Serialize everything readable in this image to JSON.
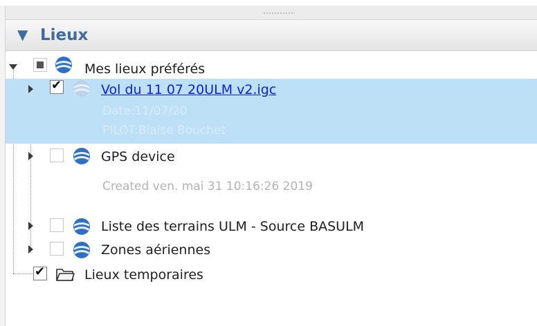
{
  "panel": {
    "title": "Lieux",
    "collapse_glyph": "▼"
  },
  "tree": {
    "root": {
      "label": "Mes lieux préférés",
      "state": "partial",
      "expanded": true,
      "icon": "globe-icon"
    },
    "children": [
      {
        "label": "Vol du 11 07 20ULM v2.igc",
        "checked": true,
        "selected": true,
        "link": true,
        "icon": "globe-icon",
        "description": [
          "Date:11/07/20",
          "PILOT:Blaise Bouchet"
        ]
      },
      {
        "label": "GPS device",
        "checked": false,
        "icon": "globe-icon",
        "description": [
          "Created ven. mai 31 10:16:26 2019"
        ]
      },
      {
        "label": "Liste des terrains ULM - Source BASULM",
        "checked": false,
        "icon": "globe-icon"
      },
      {
        "label": "Zones aériennes",
        "checked": false,
        "icon": "globe-icon"
      }
    ],
    "temporary": {
      "label": "Lieux temporaires",
      "checked": true,
      "icon": "folder-icon"
    }
  },
  "colors": {
    "header_text": "#3e6c9d",
    "selection": "#bee0f7",
    "link": "#0b1fd6",
    "description": "#b3b3b3"
  }
}
